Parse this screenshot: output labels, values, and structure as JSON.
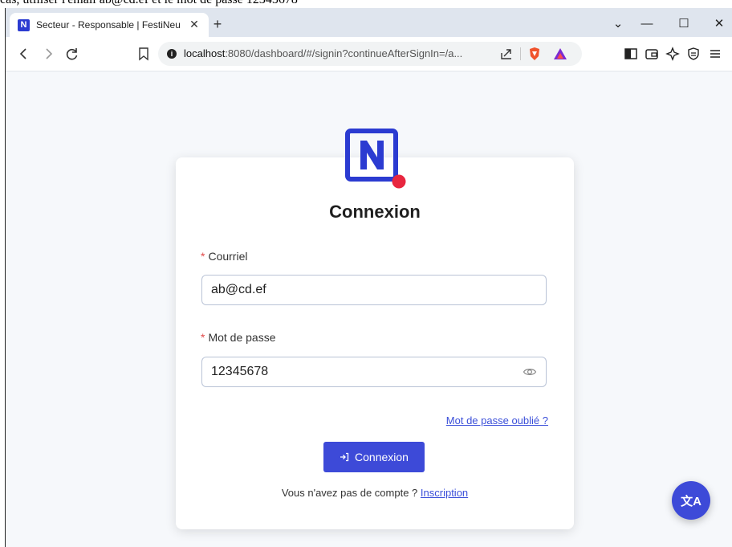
{
  "browser": {
    "tab_title": "Secteur - Responsable | FestiNeuch",
    "tab_favicon": "N",
    "tab_close": "✕",
    "new_tab": "+",
    "win_controls": {
      "list": "⌄",
      "minimize": "—",
      "maximize": "☐",
      "close": "✕"
    },
    "url_host": "localhost",
    "url_rest": ":8080/dashboard/#/signin?continueAfterSignIn=/a..."
  },
  "top_strip_text": "cas, utiliser l'email ab@cd.ef et le mot de passe 12345678",
  "login": {
    "title": "Connexion",
    "email_label": "Courriel",
    "email_value": "ab@cd.ef",
    "password_label": "Mot de passe",
    "password_value": "12345678",
    "forgot_link": "Mot de passe oublié ?",
    "submit_label": "Connexion",
    "no_account_text": "Vous n'avez pas de compte ?",
    "signup_link": "Inscription",
    "required_mark": "*"
  },
  "fab": {
    "label": "文A"
  },
  "colors": {
    "primary": "#3d4ad8",
    "link": "#3b4fd9",
    "logo": "#2b3bd1",
    "logo_dot": "#e8263f"
  }
}
